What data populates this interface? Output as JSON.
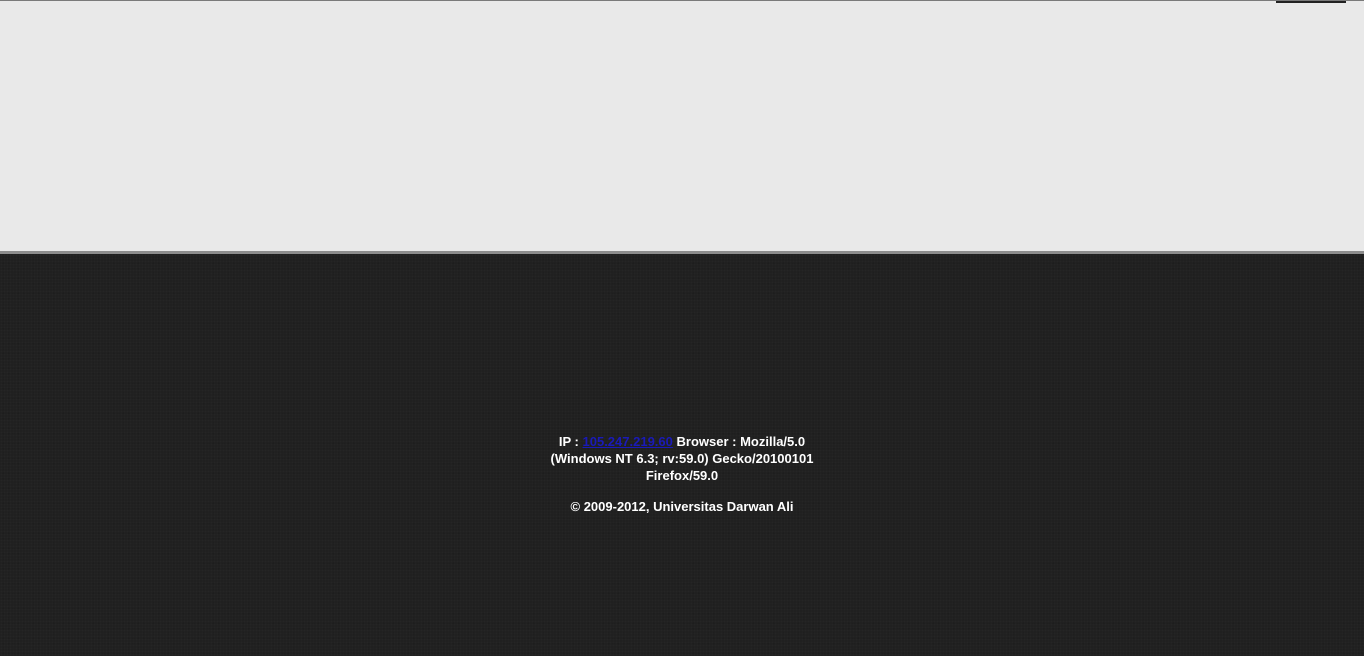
{
  "footer": {
    "ip_label": "IP :",
    "ip_value": "105.247.219.60",
    "browser_label": "Browser :",
    "browser_value": "Mozilla/5.0 (Windows NT 6.3; rv:59.0) Gecko/20100101 Firefox/59.0",
    "copyright": "© 2009-2012, Universitas Darwan Ali"
  },
  "colors": {
    "top_panel": "#e9e9e9",
    "footer_background": "#202020",
    "link": "#1a1ab8",
    "footer_text": "#ffffff"
  }
}
